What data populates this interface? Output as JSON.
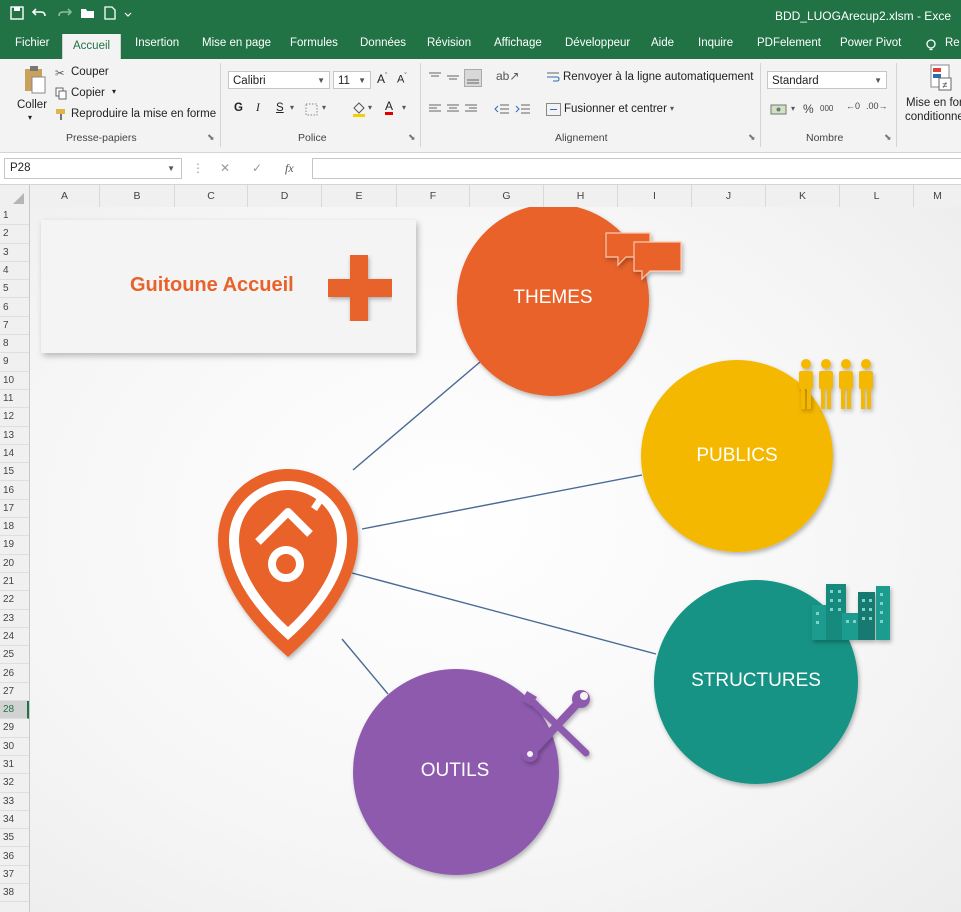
{
  "window": {
    "title": "BDD_LUOGArecup2.xlsm  -  Exce"
  },
  "tabs": [
    "Fichier",
    "Accueil",
    "Insertion",
    "Mise en page",
    "Formules",
    "Données",
    "Révision",
    "Affichage",
    "Développeur",
    "Aide",
    "Inquire",
    "PDFelement",
    "Power Pivot",
    "Re"
  ],
  "active_tab": "Accueil",
  "ribbon": {
    "clipboard": {
      "paste": "Coller",
      "cut": "Couper",
      "copy": "Copier",
      "format_painter": "Reproduire la mise en forme",
      "label": "Presse-papiers"
    },
    "font": {
      "name": "Calibri",
      "size": "11",
      "bold": "G",
      "italic": "I",
      "underline": "S",
      "label": "Police"
    },
    "alignment": {
      "wrap": "Renvoyer à la ligne automatiquement",
      "merge": "Fusionner et centrer",
      "label": "Alignement"
    },
    "number": {
      "format": "Standard",
      "label": "Nombre"
    },
    "cond_format": {
      "line1": "Mise en for",
      "line2": "conditionne"
    }
  },
  "formula_bar": {
    "cell_ref": "P28",
    "fx": "fx",
    "value": ""
  },
  "columns": [
    "A",
    "B",
    "C",
    "D",
    "E",
    "F",
    "G",
    "H",
    "I",
    "J",
    "K",
    "L",
    "M"
  ],
  "rows": [
    "1",
    "2",
    "3",
    "4",
    "5",
    "6",
    "7",
    "8",
    "9",
    "10",
    "11",
    "12",
    "13",
    "14",
    "15",
    "16",
    "17",
    "18",
    "19",
    "20",
    "21",
    "22",
    "23",
    "24",
    "25",
    "26",
    "27",
    "28",
    "29",
    "30",
    "31",
    "32",
    "33",
    "34",
    "35",
    "36",
    "37",
    "38"
  ],
  "selected_row": "28",
  "diagram": {
    "title": "Guitoune Accueil",
    "nodes": {
      "themes": {
        "label": "THEMES",
        "color": "#e8622b"
      },
      "publics": {
        "label": "PUBLICS",
        "color": "#f5b800"
      },
      "structures": {
        "label": "STRUCTURES",
        "color": "#169384"
      },
      "outils": {
        "label": "OUTILS",
        "color": "#8e5aae"
      }
    },
    "pin_color": "#e8622b",
    "line_color": "#4a6a94"
  }
}
